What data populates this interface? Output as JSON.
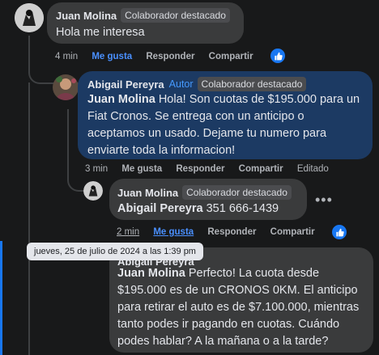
{
  "comments": [
    {
      "author": "Juan Molina",
      "badge": "Colaborador destacado",
      "text": "Hola me interesa",
      "time": "4 min",
      "like": "Me gusta",
      "reply": "Responder",
      "share": "Compartir"
    },
    {
      "author": "Abigail Pereyra",
      "role": "Autor",
      "badge": "Colaborador destacado",
      "mention": "Juan Molina",
      "text_line1": "Hola! Son cuotas de $195.000 para un",
      "text_line2": "Fiat Cronos. Se entrega con un anticipo o",
      "text_line3": "aceptamos un usado. Dejame tu numero para",
      "text_line4": "enviarte toda la informacion!",
      "time": "3 min",
      "like": "Me gusta",
      "reply": "Responder",
      "share": "Compartir",
      "edited": "Editado"
    },
    {
      "author": "Juan Molina",
      "badge": "Colaborador destacado",
      "mention": "Abigail Pereyra",
      "text": "351 666-1439",
      "time": "2 min",
      "like": "Me gusta",
      "reply": "Responder",
      "share": "Compartir"
    },
    {
      "author_partial": "Abigail Pereyra",
      "mention": "Juan Molina",
      "text_line1": "Perfecto! La cuota desde",
      "text_line2": "$195.000 es de un CRONOS 0KM. El anticipo",
      "text_line3": "para retirar el auto es de $7.100.000, mientras",
      "text_line4": "tanto podes ir pagando en cuotas. Cuándo",
      "text_line5": "podes hablar? A la mañana o a la tarde?"
    }
  ],
  "tooltip": "jueves, 25 de julio de 2024 a las 1:39 pm",
  "colors": {
    "blue_bubble": "#1c3a63",
    "dark_bubble": "#3a3b3c",
    "like_blue": "#1877f2"
  }
}
